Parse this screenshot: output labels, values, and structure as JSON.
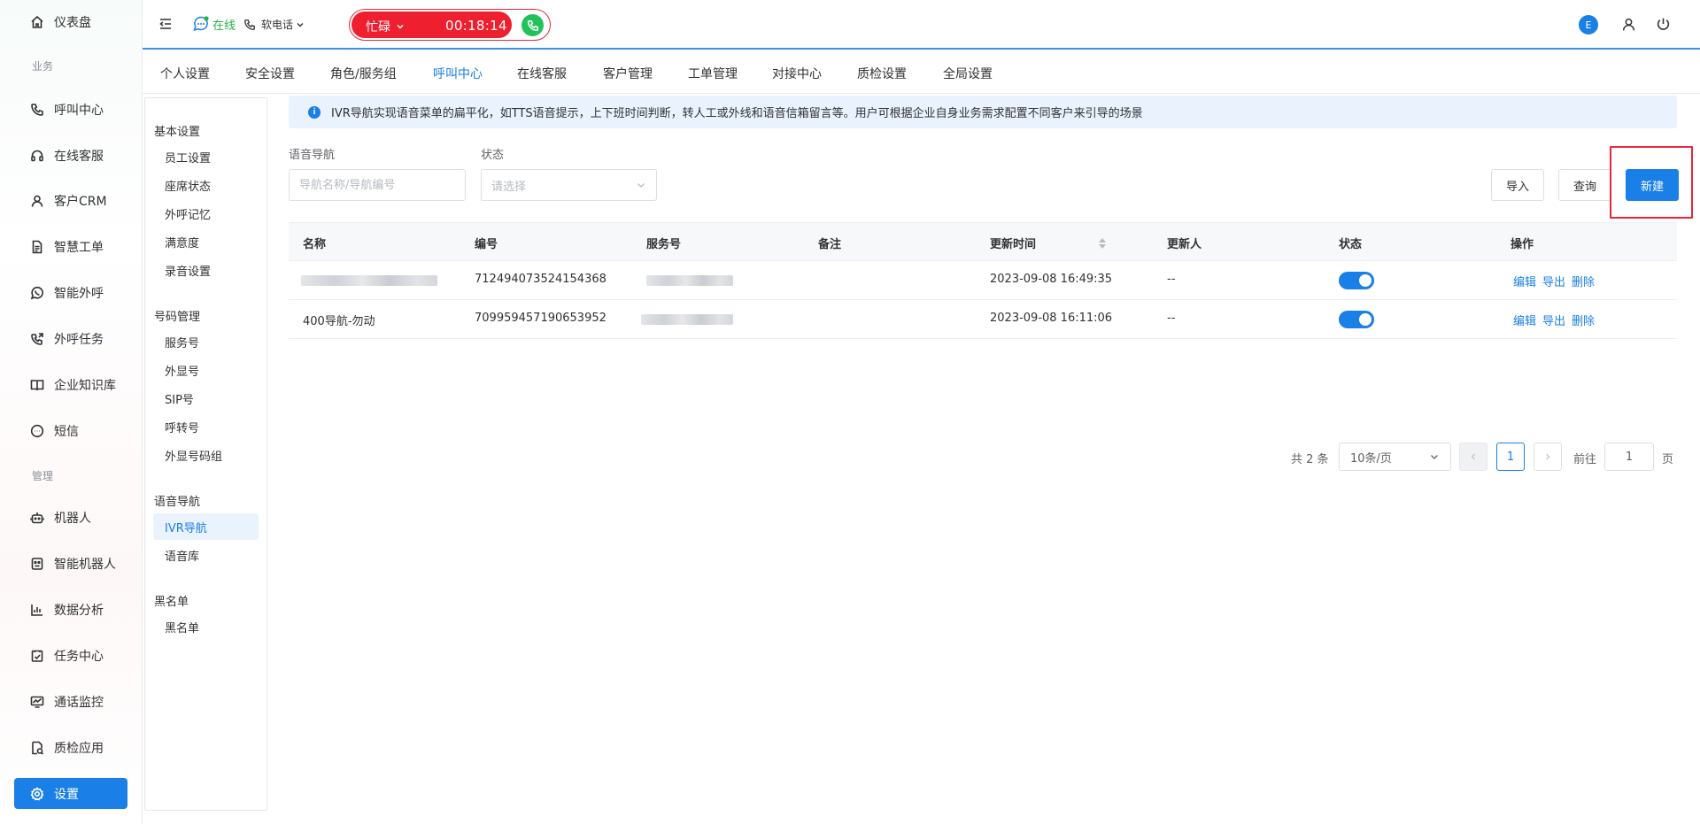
{
  "sidebar": {
    "items": [
      {
        "label": "仪表盘",
        "icon": "home-icon"
      },
      {
        "label": "呼叫中心",
        "icon": "phone-icon"
      },
      {
        "label": "在线客服",
        "icon": "headset-icon"
      },
      {
        "label": "客户CRM",
        "icon": "user-icon"
      },
      {
        "label": "智慧工单",
        "icon": "document-icon"
      },
      {
        "label": "智能外呼",
        "icon": "whatsapp-icon"
      },
      {
        "label": "外呼任务",
        "icon": "phone-forward-icon"
      },
      {
        "label": "企业知识库",
        "icon": "book-icon"
      },
      {
        "label": "短信",
        "icon": "sms-icon"
      },
      {
        "label": "机器人",
        "icon": "robot-icon"
      },
      {
        "label": "智能机器人",
        "icon": "smart-robot-icon"
      },
      {
        "label": "数据分析",
        "icon": "bar-chart-icon"
      },
      {
        "label": "任务中心",
        "icon": "checklist-icon"
      },
      {
        "label": "通话监控",
        "icon": "monitor-icon"
      },
      {
        "label": "质检应用",
        "icon": "inspection-icon"
      },
      {
        "label": "设置",
        "icon": "gear-icon"
      }
    ],
    "section_business": "业务",
    "section_manage": "管理"
  },
  "topbar": {
    "status_text": "在线",
    "softphone_label": "软电话",
    "call_status": "忙碌",
    "call_timer": "00:18:14",
    "avatar_letter": "E"
  },
  "tabs": [
    "个人设置",
    "安全设置",
    "角色/服务组",
    "呼叫中心",
    "在线客服",
    "客户管理",
    "工单管理",
    "对接中心",
    "质检设置",
    "全局设置"
  ],
  "subnav": {
    "groups": [
      {
        "title": "基本设置",
        "items": [
          "员工设置",
          "座席状态",
          "外呼记忆",
          "满意度",
          "录音设置"
        ]
      },
      {
        "title": "号码管理",
        "items": [
          "服务号",
          "外显号",
          "SIP号",
          "呼转号",
          "外显号码组"
        ]
      },
      {
        "title": "语音导航",
        "items": [
          "IVR导航",
          "语音库"
        ]
      },
      {
        "title": "黑名单",
        "items": [
          "黑名单"
        ]
      }
    ]
  },
  "main": {
    "alert_text": "IVR导航实现语音菜单的扁平化，如TTS语音提示，上下班时间判断，转人工或外线和语音信箱留言等。用户可根据企业自身业务需求配置不同客户来引导的场景",
    "filter": {
      "nav_label": "语音导航",
      "nav_placeholder": "导航名称/导航编号",
      "status_label": "状态",
      "status_placeholder": "请选择"
    },
    "buttons": {
      "import": "导入",
      "query": "查询",
      "create": "新建"
    },
    "table": {
      "headers": [
        "名称",
        "编号",
        "服务号",
        "备注",
        "更新时间",
        "更新人",
        "状态",
        "操作"
      ],
      "rows": [
        {
          "name": "",
          "code": "712494073524154368",
          "service": "",
          "note": "",
          "updated": "2023-09-08 16:49:35",
          "updater": "--",
          "enabled": true
        },
        {
          "name": "400导航-勿动",
          "code": "709959457190653952",
          "service": "",
          "note": "",
          "updated": "2023-09-08 16:11:06",
          "updater": "--",
          "enabled": true
        }
      ],
      "actions": {
        "edit": "编辑",
        "export": "导出",
        "delete": "删除"
      }
    },
    "pagination": {
      "total": "共 2 条",
      "page_size": "10条/页",
      "current": "1",
      "goto_prefix": "前往",
      "goto_value": "1",
      "goto_suffix": "页"
    }
  },
  "colors": {
    "primary": "#1a7fe6",
    "busy": "#ee1f2f",
    "online": "#26b24a"
  }
}
